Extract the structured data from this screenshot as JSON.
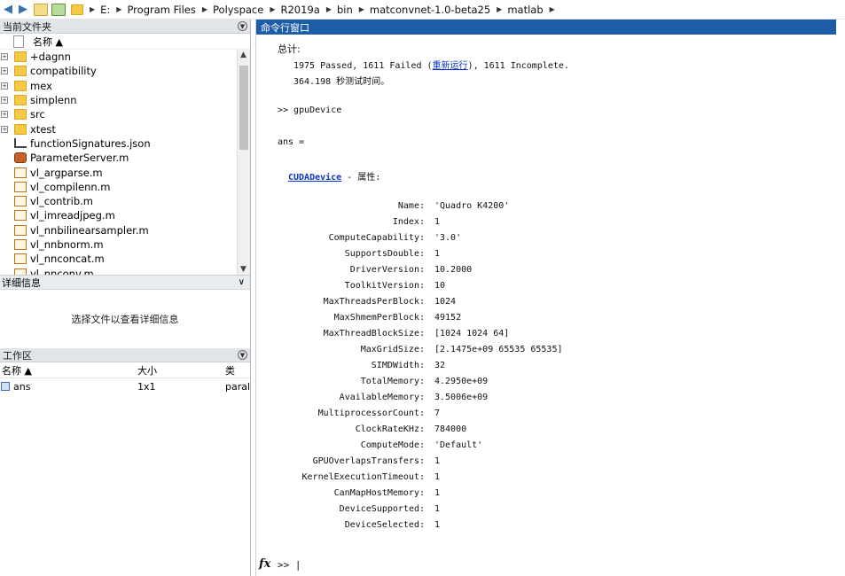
{
  "address_bar": {
    "icons": [
      "back-arrow-icon",
      "forward-arrow-icon",
      "up-folder-icon",
      "browse-folder-icon",
      "folder-icon"
    ],
    "breadcrumbs": [
      "E:",
      "Program Files",
      "Polyspace",
      "R2019a",
      "bin",
      "matconvnet-1.0-beta25",
      "matlab"
    ]
  },
  "current_folder": {
    "title": "当前文件夹",
    "column_name": "名称 ▲",
    "items": [
      {
        "name": "+dagnn",
        "type": "folder",
        "expandable": true
      },
      {
        "name": "compatibility",
        "type": "folder",
        "expandable": true
      },
      {
        "name": "mex",
        "type": "folder",
        "expandable": true
      },
      {
        "name": "simplenn",
        "type": "folder",
        "expandable": true
      },
      {
        "name": "src",
        "type": "folder",
        "expandable": true
      },
      {
        "name": "xtest",
        "type": "folder",
        "expandable": true
      },
      {
        "name": "functionSignatures.json",
        "type": "json",
        "expandable": false
      },
      {
        "name": "ParameterServer.m",
        "type": "class",
        "expandable": false
      },
      {
        "name": "vl_argparse.m",
        "type": "mfile",
        "expandable": false
      },
      {
        "name": "vl_compilenn.m",
        "type": "mfile",
        "expandable": false
      },
      {
        "name": "vl_contrib.m",
        "type": "mfile",
        "expandable": false
      },
      {
        "name": "vl_imreadjpeg.m",
        "type": "mfile",
        "expandable": false
      },
      {
        "name": "vl_nnbilinearsampler.m",
        "type": "mfile",
        "expandable": false
      },
      {
        "name": "vl_nnbnorm.m",
        "type": "mfile",
        "expandable": false
      },
      {
        "name": "vl_nnconcat.m",
        "type": "mfile",
        "expandable": false
      },
      {
        "name": "vl_nnconv.m",
        "type": "mfile",
        "expandable": false
      }
    ]
  },
  "details": {
    "title": "详细信息",
    "placeholder": "选择文件以查看详细信息"
  },
  "workspace": {
    "title": "工作区",
    "columns": [
      "名称 ▲",
      "大小",
      "类"
    ],
    "rows": [
      {
        "name": "ans",
        "size": "1x1",
        "class": "paral"
      }
    ]
  },
  "command_window": {
    "title": "命令行窗口",
    "summary_label": "总计:",
    "results_prefix": "1975 Passed, 1611 Failed (",
    "rerun_link": "重新运行",
    "results_suffix": "), 1611 Incomplete.",
    "time_line": "364.198 秒测试时间。",
    "command": ">> gpuDevice",
    "ans_line": "ans =",
    "object_class": "CUDADevice",
    "properties_label": " - 属性:",
    "properties": [
      {
        "name": "Name:",
        "value": "'Quadro K4200'"
      },
      {
        "name": "Index:",
        "value": "1"
      },
      {
        "name": "ComputeCapability:",
        "value": "'3.0'"
      },
      {
        "name": "SupportsDouble:",
        "value": "1"
      },
      {
        "name": "DriverVersion:",
        "value": "10.2000"
      },
      {
        "name": "ToolkitVersion:",
        "value": "10"
      },
      {
        "name": "MaxThreadsPerBlock:",
        "value": "1024"
      },
      {
        "name": "MaxShmemPerBlock:",
        "value": "49152"
      },
      {
        "name": "MaxThreadBlockSize:",
        "value": "[1024 1024 64]"
      },
      {
        "name": "MaxGridSize:",
        "value": "[2.1475e+09 65535 65535]"
      },
      {
        "name": "SIMDWidth:",
        "value": "32"
      },
      {
        "name": "TotalMemory:",
        "value": "4.2950e+09"
      },
      {
        "name": "AvailableMemory:",
        "value": "3.5006e+09"
      },
      {
        "name": "MultiprocessorCount:",
        "value": "7"
      },
      {
        "name": "ClockRateKHz:",
        "value": "784000"
      },
      {
        "name": "ComputeMode:",
        "value": "'Default'"
      },
      {
        "name": "GPUOverlapsTransfers:",
        "value": "1"
      },
      {
        "name": "KernelExecutionTimeout:",
        "value": "1"
      },
      {
        "name": "CanMapHostMemory:",
        "value": "1"
      },
      {
        "name": "DeviceSupported:",
        "value": "1"
      },
      {
        "name": "DeviceSelected:",
        "value": "1"
      }
    ],
    "fx_label": "fx",
    "prompt": ">> |"
  }
}
